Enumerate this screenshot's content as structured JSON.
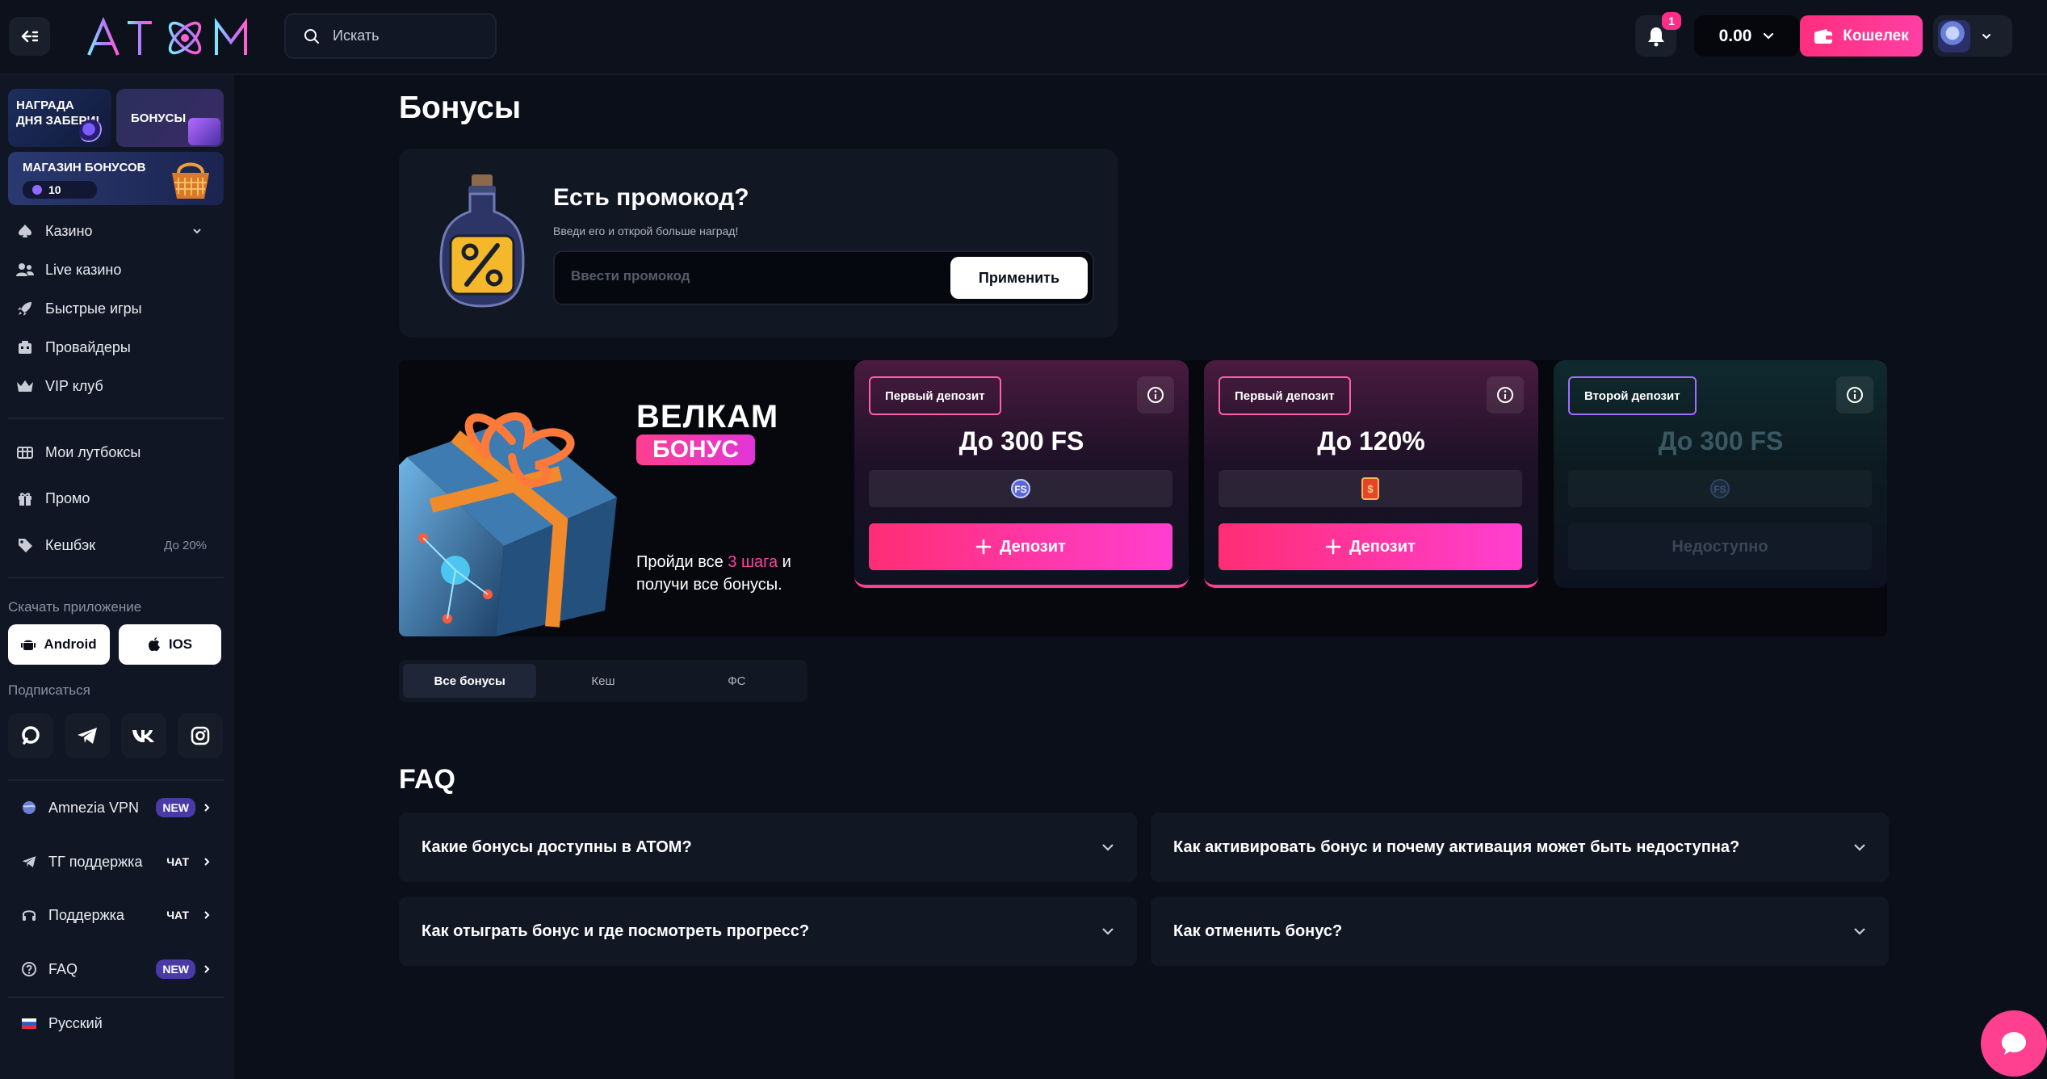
{
  "header": {
    "logo_text": "ATOM",
    "search_placeholder": "Искать",
    "notifications_count": "1",
    "balance": "0.00",
    "wallet_label": "Кошелек"
  },
  "sidebar": {
    "daily_reward": "НАГРАДА ДНЯ ЗАБЕРИ!",
    "bonuses_tile": "БОНУСЫ",
    "bonus_shop": "МАГАЗИН БОНУСОВ",
    "bonus_shop_count": "10",
    "nav": [
      {
        "label": "Казино"
      },
      {
        "label": "Live казино"
      },
      {
        "label": "Быстрые игры"
      },
      {
        "label": "Провайдеры"
      },
      {
        "label": "VIP клуб"
      }
    ],
    "nav2": [
      {
        "label": "Мои лутбоксы"
      },
      {
        "label": "Промо"
      },
      {
        "label": "Кешбэк",
        "chip": "До 20%"
      }
    ],
    "download_label": "Скачать приложение",
    "android_label": "Android",
    "ios_label": "IOS",
    "subscribe_label": "Подписаться",
    "links": [
      {
        "label": "Amnezia VPN",
        "tag": "NEW"
      },
      {
        "label": "ТГ поддержка",
        "tag": "ЧАТ"
      },
      {
        "label": "Поддержка",
        "tag": "ЧАТ"
      },
      {
        "label": "FAQ",
        "tag": "NEW"
      }
    ],
    "language": "Русский"
  },
  "main": {
    "title": "Бонусы",
    "promo": {
      "heading": "Есть промокод?",
      "sub": "Введи его и открой больше наград!",
      "placeholder": "Ввести промокод",
      "apply": "Применить"
    },
    "welcome": {
      "title": "ВЕЛКАМ",
      "badge": "БОНУС",
      "text_pre": "Пройди все ",
      "text_hl": "3 шага",
      "text_post": " и получи все бонусы."
    },
    "deposits": [
      {
        "tag": "Первый депозит",
        "amount": "До 300 FS",
        "button": "Депозит"
      },
      {
        "tag": "Первый депозит",
        "amount": "До 120%",
        "button": "Депозит"
      },
      {
        "tag": "Второй депозит",
        "amount": "До 300 FS",
        "button": "Недоступно"
      }
    ],
    "tabs": [
      "Все бонусы",
      "Кеш",
      "ФС"
    ],
    "faq_title": "FAQ",
    "faq": [
      "Какие бонусы доступны в ATOM?",
      "Как активировать бонус и почему активация может быть недоступна?",
      "Как отыграть бонус и где посмотреть прогресс?",
      "Как отменить бонус?"
    ]
  },
  "colors": {
    "accent": "#ff3f8f",
    "background": "#0b0f1a",
    "card": "#121724"
  }
}
